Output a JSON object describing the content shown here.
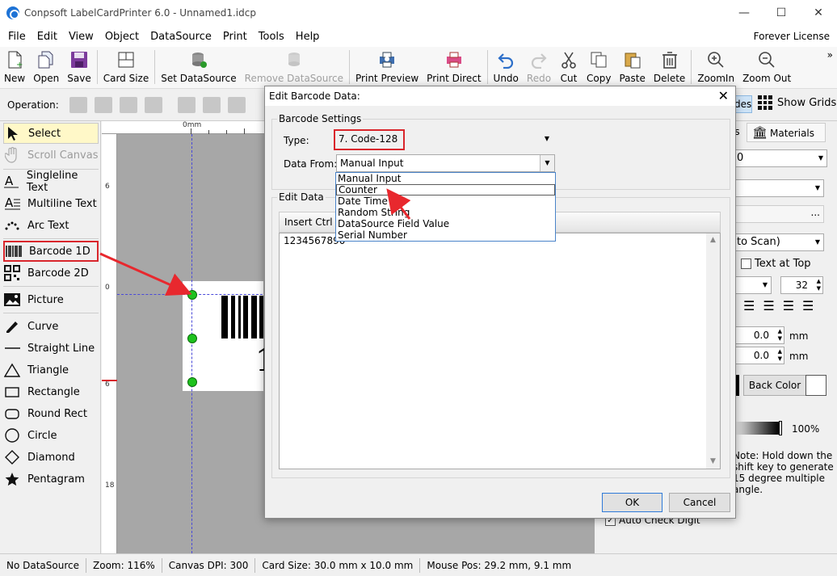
{
  "window": {
    "title": "Conpsoft LabelCardPrinter 6.0 - Unnamed1.idcp",
    "minimize": "—",
    "maximize": "☐",
    "close": "✕"
  },
  "menu": {
    "items": [
      "File",
      "Edit",
      "View",
      "Object",
      "DataSource",
      "Print",
      "Tools",
      "Help"
    ],
    "license": "Forever License"
  },
  "toolbar": {
    "new": "New",
    "open": "Open",
    "save": "Save",
    "card_size": "Card Size",
    "set_datasource": "Set DataSource",
    "remove_datasource": "Remove DataSource",
    "print_preview": "Print Preview",
    "print_direct": "Print Direct",
    "undo": "Undo",
    "redo": "Redo",
    "cut": "Cut",
    "copy": "Copy",
    "paste": "Paste",
    "delete": "Delete",
    "zoom_in": "ZoomIn",
    "zoom_out": "Zoom Out",
    "more": "»"
  },
  "operation": {
    "label": "Operation:",
    "guides": "des",
    "show_grids": "Show Grids"
  },
  "tools": {
    "select": "Select",
    "scroll_canvas": "Scroll Canvas",
    "singleline_text": "Singleline Text",
    "multiline_text": "Multiline Text",
    "arc_text": "Arc Text",
    "barcode_1d": "Barcode 1D",
    "barcode_2d": "Barcode 2D",
    "picture": "Picture",
    "curve": "Curve",
    "straight_line": "Straight Line",
    "triangle": "Triangle",
    "rectangle": "Rectangle",
    "round_rect": "Round Rect",
    "circle": "Circle",
    "diamond": "Diamond",
    "pentagram": "Pentagram"
  },
  "ruler": {
    "top_unit": "0mm",
    "left_marks": [
      "6",
      "0",
      "6",
      "18"
    ]
  },
  "canvas": {
    "digit": "1"
  },
  "right_panel": {
    "tab_partial": "es",
    "tab_materials": "Materials",
    "combo1": "0",
    "combo4": "to Scan)",
    "text_at_top": "Text at Top",
    "font_size": "32",
    "val_x": "0.0",
    "val_y": "0.0",
    "unit": "mm",
    "back_color": "Back Color",
    "opacity": "100%",
    "note": "Note: Hold down the shift key to generate 15 degree multiple angle.",
    "auto_check": "Auto Check Digit",
    "ellipsis": "..."
  },
  "dialog": {
    "title": "Edit Barcode Data:",
    "barcode_settings": "Barcode Settings",
    "type_label": "Type:",
    "type_value": "7.  Code-128",
    "data_from_label": "Data From:",
    "data_from_value": "Manual Input",
    "data_from_options": [
      "Manual Input",
      "Counter",
      "Date Time",
      "Random String",
      "DataSource Field Value",
      "Serial Number"
    ],
    "edit_data": "Edit Data",
    "insert_ctrl": "Insert Ctrl",
    "text_value": "1234567890",
    "ok": "OK",
    "cancel": "Cancel"
  },
  "status": {
    "datasource": "No DataSource",
    "zoom": "Zoom: 116%",
    "dpi": "Canvas DPI: 300",
    "card_size": "Card Size: 30.0 mm x 10.0 mm",
    "mouse_pos": "Mouse Pos: 29.2 mm, 9.1 mm"
  },
  "colors": {
    "accent_red": "#d9262c",
    "handle_green": "#1ec21e",
    "guide_blue": "#4a4ad8"
  }
}
